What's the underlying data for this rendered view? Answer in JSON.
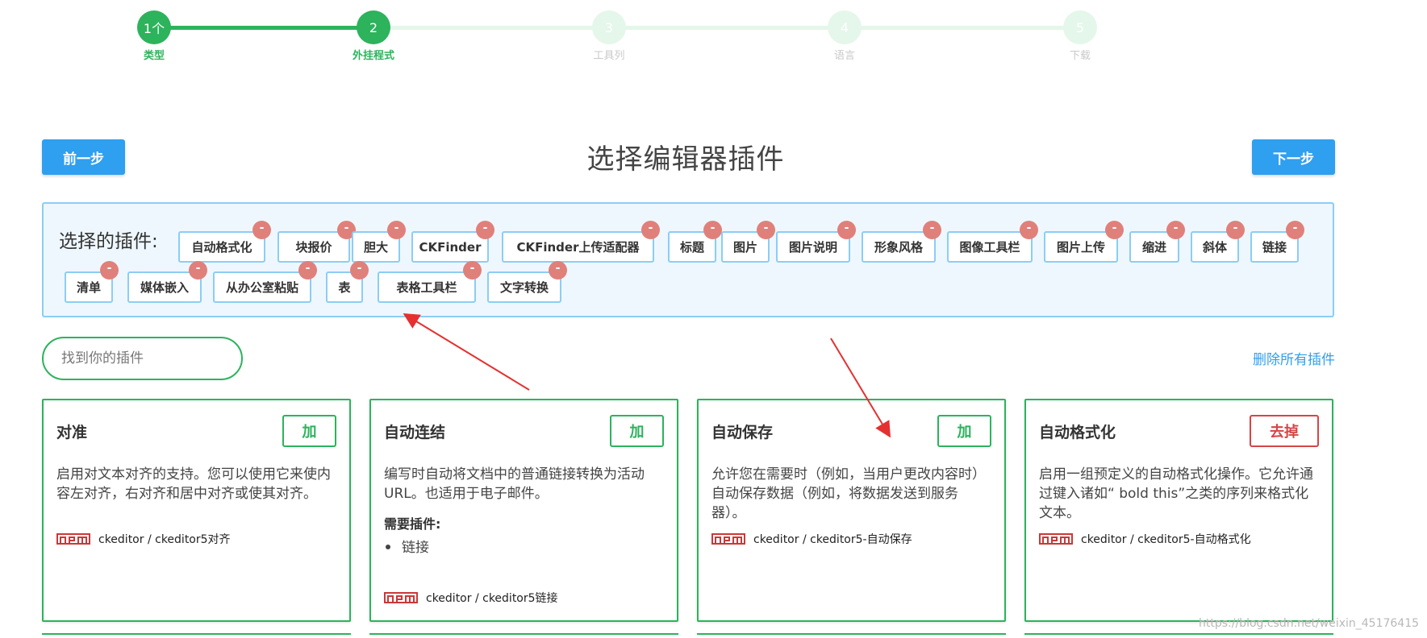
{
  "stepper": {
    "steps": [
      {
        "number": "1个",
        "label": "类型",
        "state": "active"
      },
      {
        "number": "2",
        "label": "外挂程式",
        "state": "active"
      },
      {
        "number": "3",
        "label": "工具列",
        "state": "inactive"
      },
      {
        "number": "4",
        "label": "语言",
        "state": "inactive"
      },
      {
        "number": "5",
        "label": "下载",
        "state": "inactive"
      }
    ]
  },
  "header": {
    "prev_label": "前一步",
    "title": "选择编辑器插件",
    "next_label": "下一步"
  },
  "selected": {
    "label": "选择的插件:",
    "remove_symbol": "-",
    "chips": [
      "自动格式化",
      "块报价",
      "胆大",
      "CKFinder",
      "CKFinder上传适配器",
      "标题",
      "图片",
      "图片说明",
      "形象风格",
      "图像工具栏",
      "图片上传",
      "缩进",
      "斜体",
      "链接",
      "清单",
      "媒体嵌入",
      "从办公室粘贴",
      "表",
      "表格工具栏",
      "文字转换"
    ]
  },
  "search": {
    "placeholder": "找到你的插件"
  },
  "delete_all_label": "删除所有插件",
  "cards": [
    {
      "title": "对准",
      "button": "加",
      "description": "启用对文本对齐的支持。您可以使用它来使内容左对齐，右对齐和居中对齐或使其对齐。",
      "requires_title": "",
      "requires": [],
      "package": "ckeditor / ckeditor5对齐"
    },
    {
      "title": "自动连结",
      "button": "加",
      "description": "编写时自动将文档中的普通链接转换为活动URL。也适用于电子邮件。",
      "requires_title": "需要插件:",
      "requires": [
        "链接"
      ],
      "package": "ckeditor / ckeditor5链接"
    },
    {
      "title": "自动保存",
      "button": "加",
      "description": "允许您在需要时（例如，当用户更改内容时）自动保存数据（例如，将数据发送到服务器）。",
      "requires_title": "",
      "requires": [],
      "package": "ckeditor / ckeditor5-自动保存"
    },
    {
      "title": "自动格式化",
      "button": "去掉",
      "description": "启用一组预定义的自动格式化操作。它允许通过键入诸如“ bold this”之类的序列来格式化文本。",
      "requires_title": "",
      "requires": [],
      "package": "ckeditor / ckeditor5-自动格式化"
    }
  ],
  "watermark": "https://blog.csdn.net/weixin_45176415",
  "colors": {
    "green": "#2cb35c",
    "blue": "#2f9ff0",
    "chip_border": "#8ccdf4",
    "remove_red": "#e0807a",
    "danger": "#d64545",
    "arrow": "#e53030"
  },
  "icons": {
    "npm": "npm-logo-icon",
    "arrow": "annotation-arrow"
  }
}
